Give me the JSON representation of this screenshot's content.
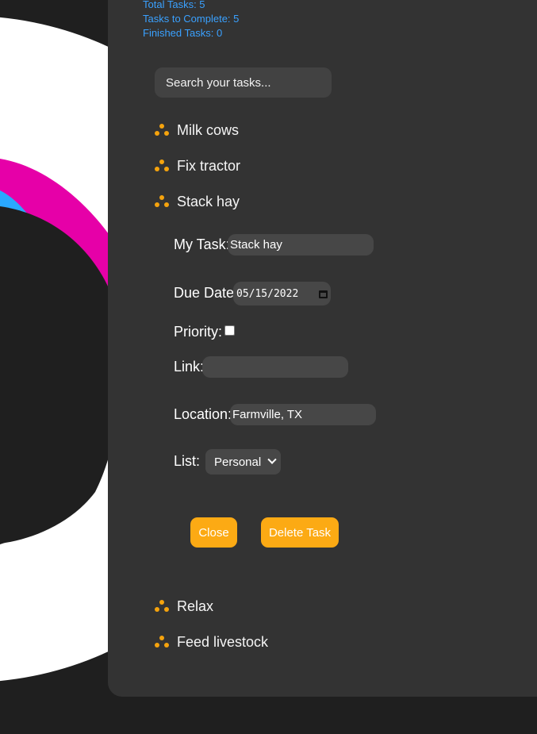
{
  "stats": {
    "total": "Total Tasks: 5",
    "to_complete": "Tasks to Complete: 5",
    "finished": "Finished Tasks: 0"
  },
  "search": {
    "placeholder": "Search your tasks..."
  },
  "tasks": [
    {
      "label": "Milk cows"
    },
    {
      "label": "Fix tractor"
    },
    {
      "label": "Stack hay"
    },
    {
      "label": "Relax"
    },
    {
      "label": "Feed livestock"
    }
  ],
  "editor": {
    "task_label": "My Task:",
    "task_value": "Stack hay",
    "due_label": "Due Date:",
    "due_value": "05/15/2022",
    "priority_label": "Priority:",
    "priority_checked": false,
    "link_label": "Link:",
    "link_value": "",
    "location_label": "Location:",
    "location_value": "Farmville, TX",
    "list_label": "List:",
    "list_selected": "Personal",
    "close_label": "Close",
    "delete_label": "Delete Task"
  },
  "colors": {
    "accent": "#fcaa14",
    "stats_text": "#3aa1ff",
    "panel": "#333333",
    "background": "#1f1f1f",
    "art_magenta": "#e600a8",
    "art_blue": "#2aa8ff"
  }
}
